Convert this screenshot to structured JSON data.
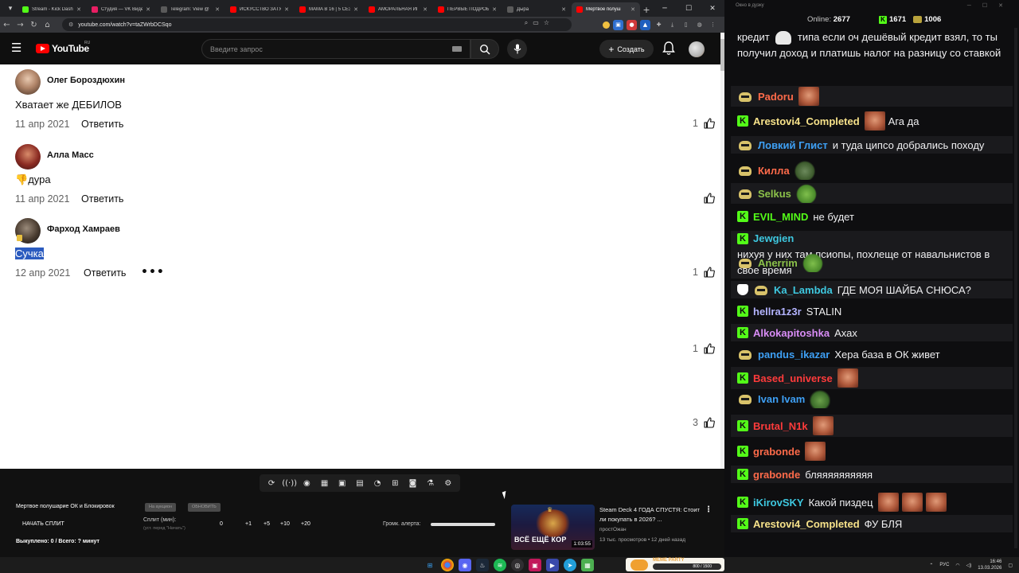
{
  "browser": {
    "tabs": [
      {
        "label": "Stream - Kick Dash",
        "color": "#53fc18"
      },
      {
        "label": "Студия — VK Виде",
        "color": "#e91e63"
      },
      {
        "label": "Telegram: View @",
        "color": "#5a5a5a"
      },
      {
        "label": "ИСКУССТВО ЗАТУ",
        "color": "#ff0000"
      },
      {
        "label": "MAMA В 16 | 5 СЕЗ",
        "color": "#ff0000"
      },
      {
        "label": "АМОРАЛЬНАЯ ИГ",
        "color": "#ff0000"
      },
      {
        "label": "ПЕРВЫЕ ПОДРОБ",
        "color": "#ff0000"
      },
      {
        "label": "Дыра",
        "color": "#5a5a5a"
      },
      {
        "label": "Мертвое полуш",
        "color": "#ff0000",
        "active": true
      }
    ],
    "url": "youtube.com/watch?v=taZWrbDCSqo"
  },
  "youtube": {
    "logo": "YouTube",
    "logo_region": "RU",
    "search_placeholder": "Введите запрос",
    "create_label": "Создать",
    "comments": [
      {
        "author": "Олег Бороздюхин",
        "text": "Хватает же ДЕБИЛОВ",
        "date": "11 апр 2021",
        "reply": "Ответить",
        "likes": "1"
      },
      {
        "author": "Алла Масс",
        "text": "дура",
        "emoji": "👎",
        "date": "11 апр 2021",
        "reply": "Ответить",
        "likes": ""
      },
      {
        "author": "Фарход Хамраев",
        "text": "Сучка",
        "date": "12 апр 2021",
        "reply": "Ответить",
        "likes": "1"
      }
    ],
    "extra_likes": [
      "1",
      "3"
    ]
  },
  "dock": {
    "title": "Мертвое полушарие ОК и Блокировок",
    "pill1": "На аукцион",
    "pill2": "ОБНОВИТЬ",
    "start_split": "НАЧАТЬ СПЛИТ",
    "split_label": "Сплит (мин):",
    "split_hint": "(уст. перед \"Начать\")",
    "split_values": [
      "0",
      "+1",
      "+5",
      "+10",
      "+20"
    ],
    "bought": "Выкуплено: 0 / Всего: ? минут",
    "alert_label": "Громк. алерта:",
    "alert_level": 1.0,
    "video": {
      "title": "Steam Deck 4 ГОДА СПУСТЯ: Стоит ли покупать в 2026? ...",
      "channel": "простОжан",
      "meta": "13 тыс. просмотров • 12 дней назад",
      "thumb_caption": "ВСЁ ЕЩЁ КОР",
      "duration": "1:03:55"
    }
  },
  "chat": {
    "window_title": "Окно в дуэку",
    "online_label": "Online:",
    "online_count": "2677",
    "stat_k": "1671",
    "stat_coin": "1006",
    "messages": [
      {
        "nick": "",
        "text": "кредит",
        "text2": "типа если оч дешёвый кредит взял, то ты получил доход и платишь налог на разницу со ставкой",
        "color": "#ffffff"
      },
      {
        "badge": "sub",
        "nick": "Padoru",
        "color": "#ff6b4a",
        "emote": "face",
        "text": ""
      },
      {
        "badge": "k",
        "nick": "Arestovi4_Completed",
        "color": "#f7e28a",
        "emote": "face",
        "text": "Ага да"
      },
      {
        "badge": "sub",
        "nick": "Ловкий Глист",
        "color": "#3ea0f5",
        "text": "и туда ципсо добрались походу"
      },
      {
        "badge": "sub",
        "nick": "Килла",
        "color": "#ff6b4a",
        "emote": "pepe",
        "text": ""
      },
      {
        "badge": "sub",
        "nick": "Selkus",
        "color": "#8cc24a",
        "emote": "frog",
        "text": ""
      },
      {
        "badge": "k",
        "nick": "EVIL_MIND",
        "color": "#53fc18",
        "text": "не будет"
      },
      {
        "badge": "k",
        "nick": "Jewgien",
        "color": "#3ec8e0",
        "text": "нихуя у них там псиопы, похлеще от навальнистов в свое время"
      },
      {
        "badge": "sub",
        "nick": "Anerrim",
        "color": "#8cc24a",
        "emote": "frog",
        "text": ""
      },
      {
        "badge": "shield",
        "nick": "Ka_Lambda",
        "color": "#3ec8e0",
        "text": "ГДЕ МОЯ ШАЙБА СНЮСА?"
      },
      {
        "badge": "k",
        "nick": "hellra1z3r",
        "color": "#b4b4ff",
        "text": "STALIN"
      },
      {
        "badge": "k",
        "nick": "Alkokapitoshka",
        "color": "#d88cf5",
        "text": "Ахах"
      },
      {
        "badge": "sub",
        "nick": "pandus_ikazar",
        "color": "#3ea0f5",
        "text": "Хера база в ОК живет"
      },
      {
        "badge": "k",
        "nick": "Based_universe",
        "color": "#ff3b3b",
        "emote": "face",
        "text": ""
      },
      {
        "badge": "sub",
        "nick": "Ivan Ivam",
        "color": "#3ea0f5",
        "emote": "hand",
        "text": ""
      },
      {
        "badge": "k",
        "nick": "Brutal_N1k",
        "color": "#ff3b3b",
        "emote": "face",
        "text": ""
      },
      {
        "badge": "k",
        "nick": "grabonde",
        "color": "#ff6b4a",
        "emote": "face",
        "text": ""
      },
      {
        "badge": "k",
        "nick": "grabonde",
        "color": "#ff6b4a",
        "text": "бляяяяяяяяяя"
      },
      {
        "badge": "k",
        "nick": "iKirovSKY",
        "color": "#3ec8e0",
        "text": "Какой пиздец",
        "emotes": 3
      },
      {
        "badge": "k",
        "nick": "Arestovi4_Completed",
        "color": "#f7e28a",
        "text": "ФУ БЛЯ"
      }
    ]
  },
  "taskbar": {
    "meme_tag": "MEME PARTY",
    "meme_progress": "800 / 1500",
    "lang": "РУС",
    "time": "16:46",
    "date": "13.03.2026"
  }
}
